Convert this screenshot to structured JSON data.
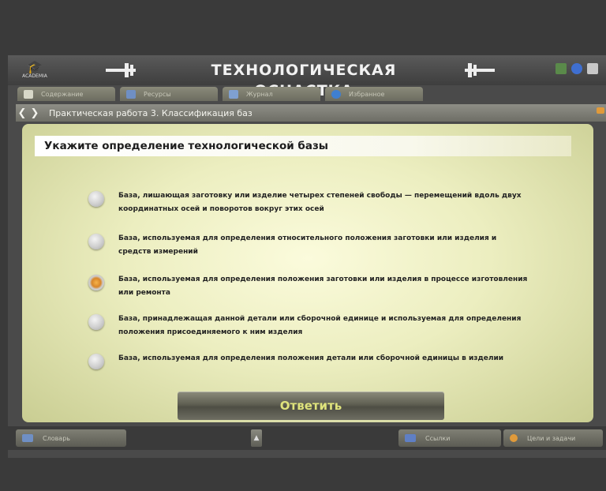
{
  "app": {
    "logo_text": "ACADEMIA",
    "title": "ТЕХНОЛОГИЧЕСКАЯ ОСНАСТКА"
  },
  "tabs": [
    {
      "label": "Содержание",
      "icon": "book-icon",
      "color": "#d8d8c8"
    },
    {
      "label": "Ресурсы",
      "icon": "resources-icon",
      "color": "#6f8fc4"
    },
    {
      "label": "Журнал",
      "icon": "journal-icon",
      "color": "#7fa0d0"
    },
    {
      "label": "Избранное",
      "icon": "globe-icon",
      "color": "#3f7fd0"
    }
  ],
  "breadcrumb": {
    "text": "Практическая работа 3. Классификация баз"
  },
  "question": "Укажите определение технологической базы",
  "options": [
    {
      "text": "База, лишающая заготовку или изделие четырех степеней свободы — перемещений вдоль двух координатных осей и поворотов вокруг этих осей",
      "selected": false
    },
    {
      "text": "База, используемая для определения относительного положения заготовки или изделия и средств измерений",
      "selected": false
    },
    {
      "text": "База, используемая для определения положения заготовки или изделия в процессе изготовления или ремонта",
      "selected": true
    },
    {
      "text": "База, принадлежащая данной детали или сборочной единице и используемая для определения положения присоединяемого к ним изделия",
      "selected": false
    },
    {
      "text": "База, используемая для определения положения детали или сборочной единицы в изделии",
      "selected": false
    }
  ],
  "answer_button": "Ответить",
  "bottom": {
    "dictionary": "Словарь",
    "references": "Ссылки",
    "goals": "Цели и задачи"
  },
  "colors": {
    "accent_orange": "#e09a3a",
    "answer_text": "#dfe37c",
    "panel_center": "#fbfbdc"
  }
}
